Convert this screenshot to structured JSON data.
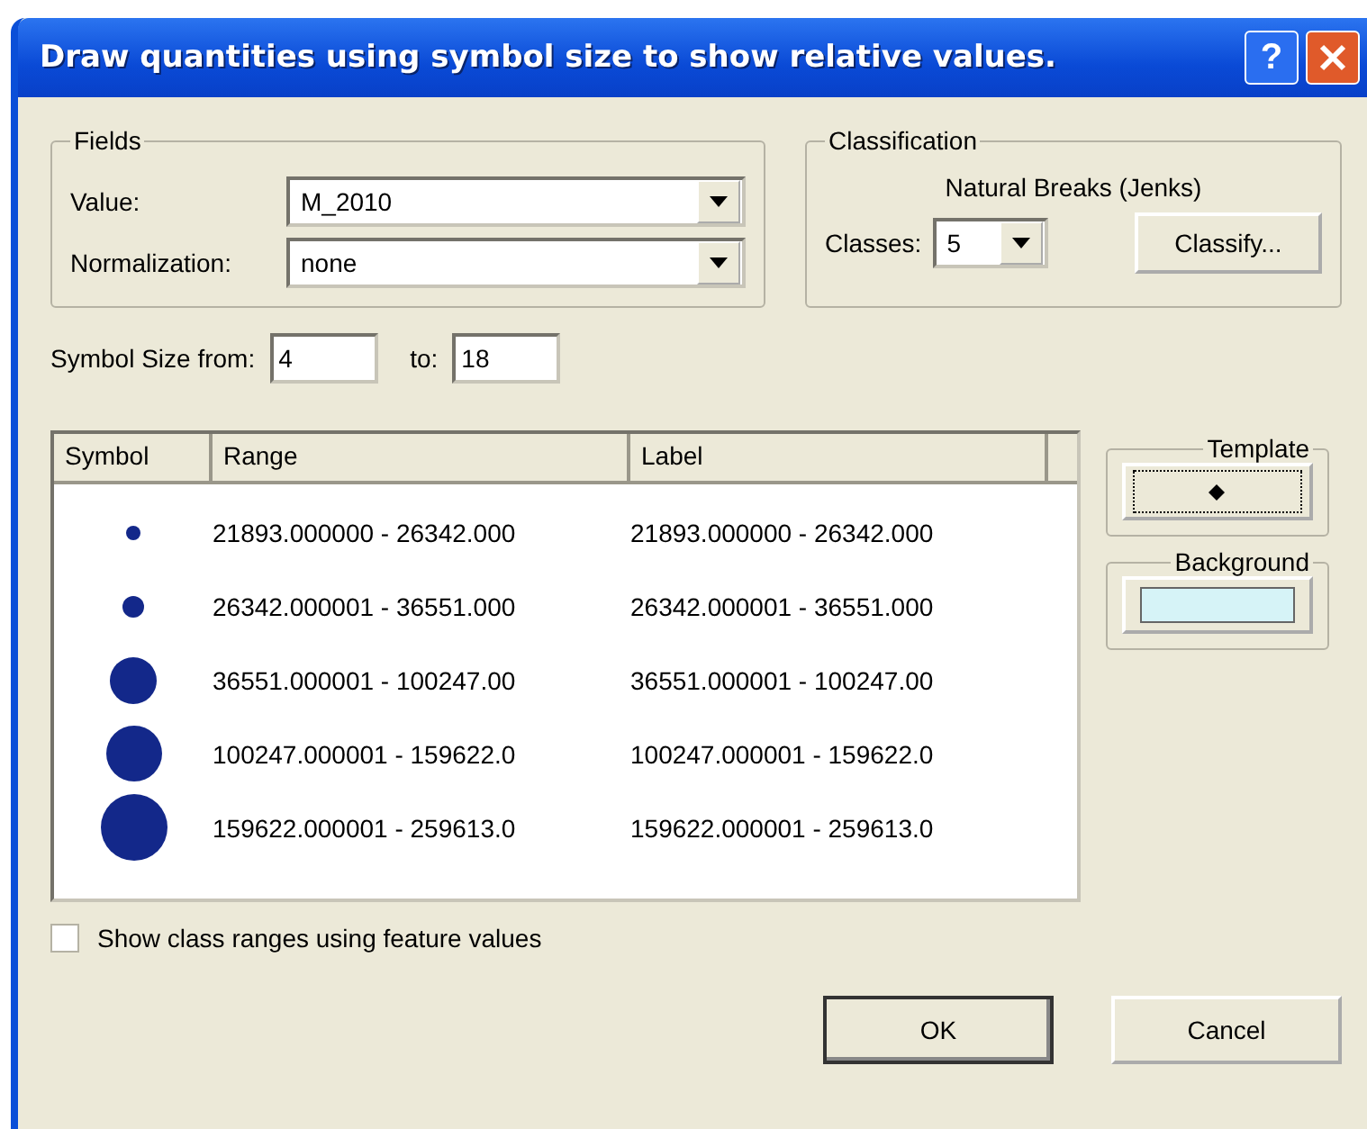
{
  "window": {
    "title": "Draw quantities using symbol size to show relative values.",
    "help": "?"
  },
  "fields": {
    "title": "Fields",
    "value_label": "Value:",
    "value": "M_2010",
    "normalization_label": "Normalization:",
    "normalization": "none"
  },
  "classification": {
    "title": "Classification",
    "method": "Natural Breaks (Jenks)",
    "classes_label": "Classes:",
    "classes": "5",
    "classify_button": "Classify..."
  },
  "symbol_size": {
    "from_label": "Symbol Size from:",
    "from": "4",
    "to_label": "to:",
    "to": "18"
  },
  "table": {
    "columns": [
      "Symbol",
      "Range",
      "Label"
    ],
    "rows": [
      {
        "kind": "xs",
        "range": "21893.000000 - 26342.000",
        "label": "21893.000000 - 26342.000"
      },
      {
        "kind": "s",
        "range": "26342.000001 - 36551.000",
        "label": "26342.000001 - 36551.000"
      },
      {
        "kind": "m",
        "range": "36551.000001 - 100247.00",
        "label": "36551.000001 - 100247.00"
      },
      {
        "kind": "l",
        "range": "100247.000001 - 159622.0",
        "label": "100247.000001 - 159622.0"
      },
      {
        "kind": "xl",
        "range": "159622.000001 - 259613.0",
        "label": "159622.000001 - 259613.0"
      }
    ]
  },
  "template": {
    "title": "Template"
  },
  "background": {
    "title": "Background",
    "color": "#d6f3f7"
  },
  "show_class_ranges": {
    "label": "Show class ranges using feature values",
    "checked": false
  },
  "buttons": [
    "OK",
    "Cancel"
  ]
}
